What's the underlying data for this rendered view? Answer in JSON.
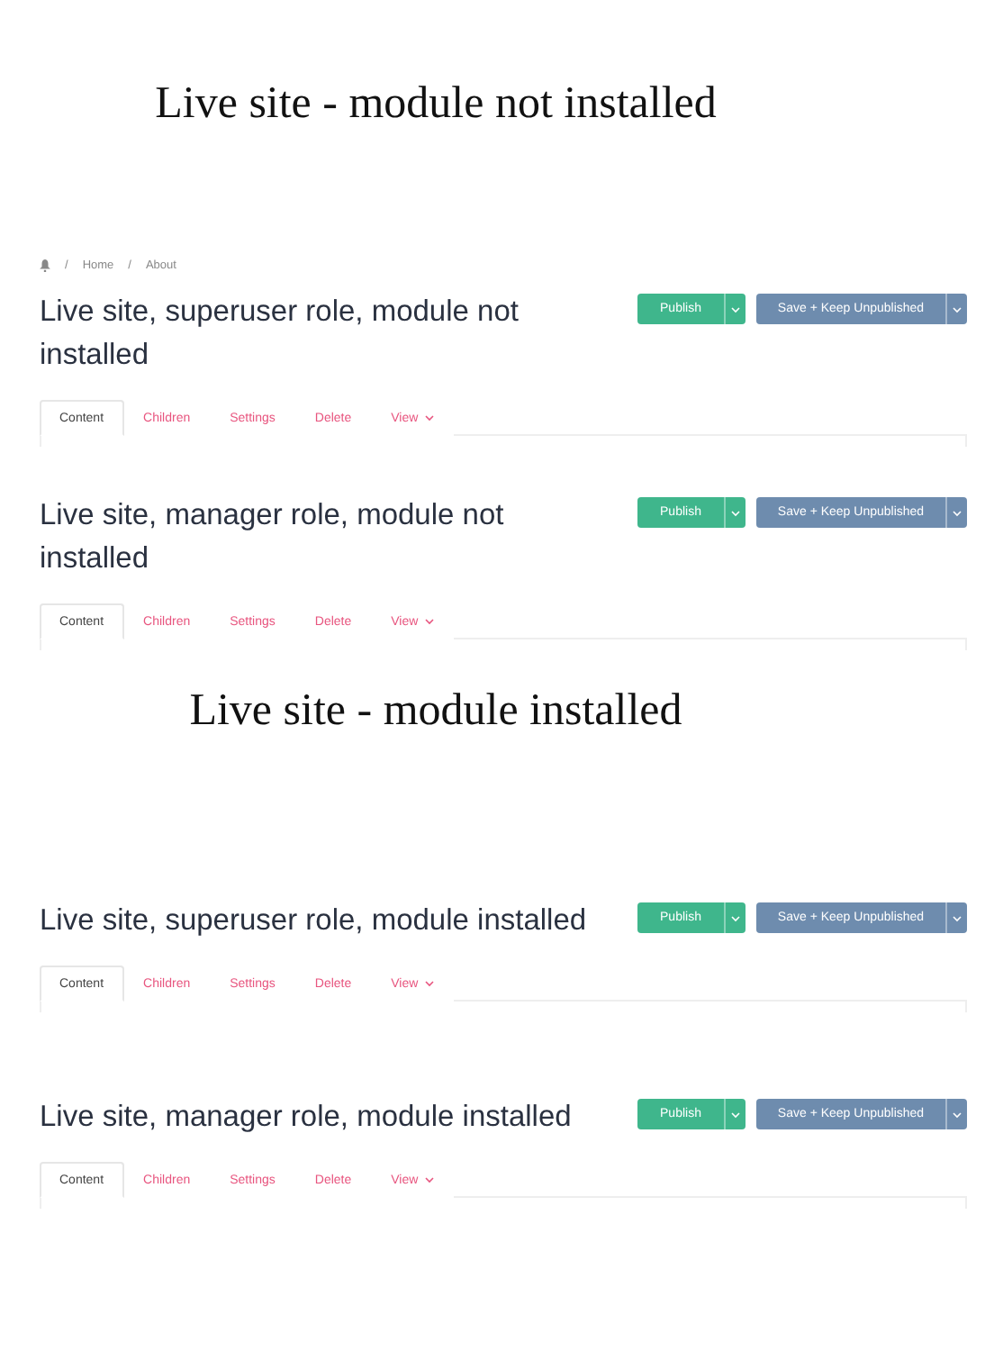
{
  "sections": [
    {
      "heading": "Live site - module not installed",
      "panels": [
        {
          "breadcrumb": {
            "separator": "/",
            "items": [
              "Home",
              "About"
            ]
          },
          "title": "Live site, superuser role, module not installed",
          "buttons": [
            {
              "label": "Publish",
              "kind": "primary"
            },
            {
              "label": "Save + Keep Unpublished",
              "kind": "secondary"
            }
          ],
          "tabs": [
            {
              "label": "Content",
              "selected": true
            },
            {
              "label": "Children",
              "selected": false
            },
            {
              "label": "Settings",
              "selected": false
            },
            {
              "label": "Delete",
              "selected": false
            },
            {
              "label": "View",
              "selected": false,
              "dropdown": true
            }
          ]
        },
        {
          "title": "Live site, manager role, module not installed",
          "buttons": [
            {
              "label": "Publish",
              "kind": "primary"
            },
            {
              "label": "Save + Keep Unpublished",
              "kind": "secondary"
            }
          ],
          "tabs": [
            {
              "label": "Content",
              "selected": true
            },
            {
              "label": "Children",
              "selected": false
            },
            {
              "label": "Settings",
              "selected": false
            },
            {
              "label": "Delete",
              "selected": false
            },
            {
              "label": "View",
              "selected": false,
              "dropdown": true
            }
          ]
        }
      ]
    },
    {
      "heading": "Live site - module installed",
      "panels": [
        {
          "title": "Live site, superuser role, module installed",
          "buttons": [
            {
              "label": "Publish",
              "kind": "primary"
            },
            {
              "label": "Save + Keep Unpublished",
              "kind": "secondary"
            }
          ],
          "tabs": [
            {
              "label": "Content",
              "selected": true
            },
            {
              "label": "Children",
              "selected": false
            },
            {
              "label": "Settings",
              "selected": false
            },
            {
              "label": "Delete",
              "selected": false
            },
            {
              "label": "View",
              "selected": false,
              "dropdown": true
            }
          ]
        },
        {
          "title": "Live site, manager role, module installed",
          "buttons": [
            {
              "label": "Publish",
              "kind": "primary"
            },
            {
              "label": "Save + Keep Unpublished",
              "kind": "secondary"
            }
          ],
          "tabs": [
            {
              "label": "Content",
              "selected": true
            },
            {
              "label": "Children",
              "selected": false
            },
            {
              "label": "Settings",
              "selected": false
            },
            {
              "label": "Delete",
              "selected": false
            },
            {
              "label": "View",
              "selected": false,
              "dropdown": true
            }
          ]
        }
      ]
    }
  ]
}
